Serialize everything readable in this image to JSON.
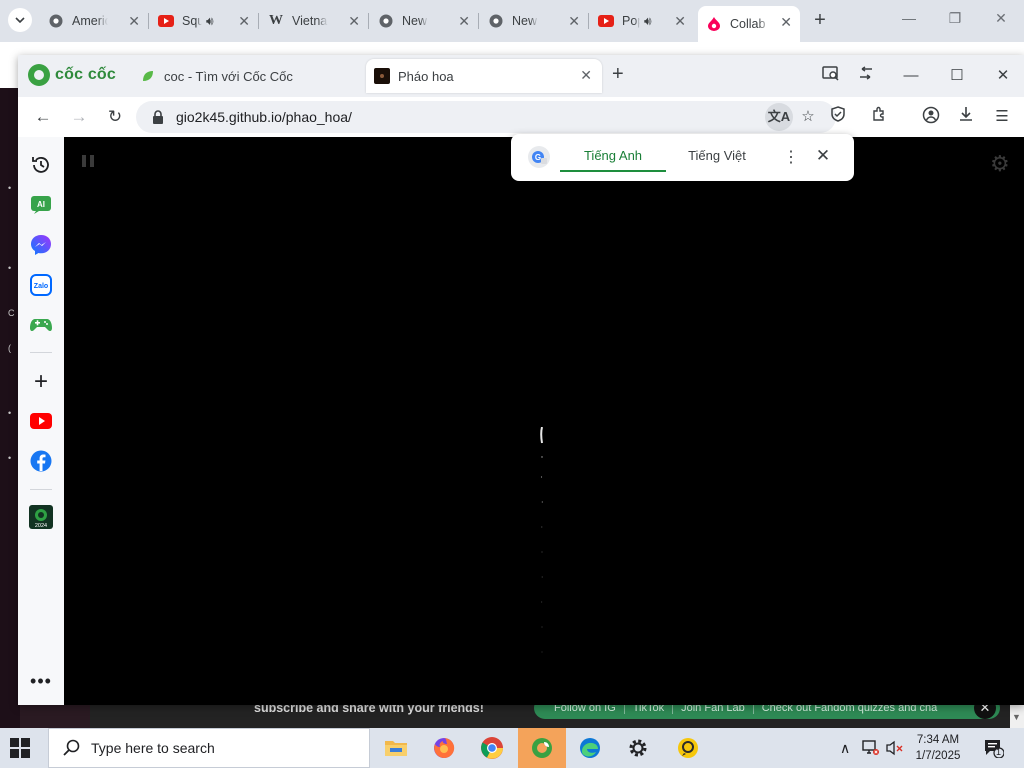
{
  "outer_browser": {
    "tabs": [
      {
        "label": "American",
        "icon": "chrome-icon"
      },
      {
        "label": "Squid Game",
        "icon": "youtube-icon",
        "audio": true
      },
      {
        "label": "Vietnam",
        "icon": "wikipedia-icon"
      },
      {
        "label": "New Tab",
        "icon": "chrome-icon"
      },
      {
        "label": "New Tab",
        "icon": "chrome-icon"
      },
      {
        "label": "Pop",
        "icon": "youtube-icon",
        "audio": true
      },
      {
        "label": "Collab",
        "icon": "fandom-icon",
        "active": true
      }
    ]
  },
  "inner_browser": {
    "brand": "cốc cốc",
    "tabs": [
      {
        "label": "coc - Tìm với Cốc Cốc"
      },
      {
        "label": "Pháo hoa",
        "active": true
      }
    ],
    "address": {
      "url": "gio2k45.github.io/phao_hoa/"
    }
  },
  "translate_popup": {
    "source_lang": "Tiếng Anh",
    "target_lang": "Tiếng Việt"
  },
  "background_page": {
    "footer_text": "subscribe and share with your friends!",
    "footer_links": [
      "Follow on IG",
      "TikTok",
      "Join Fan Lab",
      "Check out Fandom quizzes and cha"
    ]
  },
  "taskbar": {
    "search_placeholder": "Type here to search",
    "time": "7:34 AM",
    "date": "1/7/2025",
    "notification_count": "1"
  },
  "colors": {
    "accent_green": "#1e8e3e",
    "brand_green": "#2f8a3c",
    "active_taskbar_app": "#f4a35a"
  }
}
